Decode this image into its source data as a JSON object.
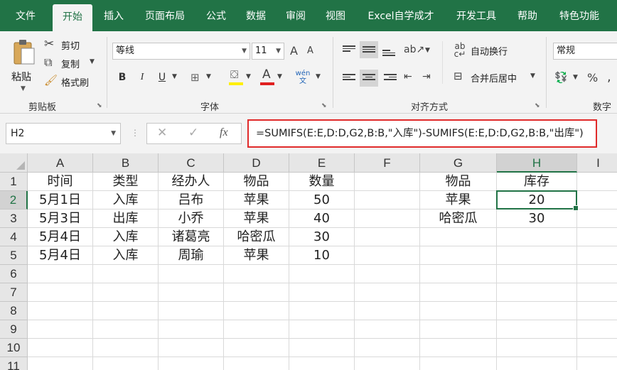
{
  "tabs": [
    {
      "label": "文件",
      "active": false
    },
    {
      "label": "开始",
      "active": true
    },
    {
      "label": "插入",
      "active": false
    },
    {
      "label": "页面布局",
      "active": false
    },
    {
      "label": "公式",
      "active": false
    },
    {
      "label": "数据",
      "active": false
    },
    {
      "label": "审阅",
      "active": false
    },
    {
      "label": "视图",
      "active": false
    },
    {
      "label": "Excel自学成才",
      "active": false
    },
    {
      "label": "开发工具",
      "active": false
    },
    {
      "label": "帮助",
      "active": false
    },
    {
      "label": "特色功能",
      "active": false
    }
  ],
  "ribbon": {
    "clipboard": {
      "paste": "粘贴",
      "cut": "剪切",
      "copy": "复制",
      "format_painter": "格式刷",
      "label": "剪贴板"
    },
    "font": {
      "name": "等线",
      "size": "11",
      "bold": "B",
      "italic": "I",
      "underline": "U",
      "grow": "A",
      "shrink": "A",
      "color_letter": "A",
      "phonetic": "wén文",
      "label": "字体"
    },
    "alignment": {
      "wrap_text": "自动换行",
      "merge_center": "合并后居中",
      "label": "对齐方式"
    },
    "number": {
      "format": "常规",
      "label": "数字"
    }
  },
  "formula_bar": {
    "name_box": "H2",
    "fx": "fx",
    "formula": "=SUMIFS(E:E,D:D,G2,B:B,\"入库\")-SUMIFS(E:E,D:D,G2,B:B,\"出库\")"
  },
  "sheet": {
    "columns": [
      "A",
      "B",
      "C",
      "D",
      "E",
      "F",
      "G",
      "H",
      "I"
    ],
    "rows": [
      "1",
      "2",
      "3",
      "4",
      "5",
      "6",
      "7",
      "8",
      "9",
      "10",
      "11"
    ],
    "selected_column": "H",
    "selected_row": "2",
    "cells": [
      [
        "时间",
        "类型",
        "经办人",
        "物品",
        "数量",
        "",
        "物品",
        "库存",
        ""
      ],
      [
        "5月1日",
        "入库",
        "吕布",
        "苹果",
        "50",
        "",
        "苹果",
        "20",
        ""
      ],
      [
        "5月3日",
        "出库",
        "小乔",
        "苹果",
        "40",
        "",
        "哈密瓜",
        "30",
        ""
      ],
      [
        "5月4日",
        "入库",
        "诸葛亮",
        "哈密瓜",
        "30",
        "",
        "",
        "",
        ""
      ],
      [
        "5月4日",
        "入库",
        "周瑜",
        "苹果",
        "10",
        "",
        "",
        "",
        ""
      ],
      [
        "",
        "",
        "",
        "",
        "",
        "",
        "",
        "",
        ""
      ],
      [
        "",
        "",
        "",
        "",
        "",
        "",
        "",
        "",
        ""
      ],
      [
        "",
        "",
        "",
        "",
        "",
        "",
        "",
        "",
        ""
      ],
      [
        "",
        "",
        "",
        "",
        "",
        "",
        "",
        "",
        ""
      ],
      [
        "",
        "",
        "",
        "",
        "",
        "",
        "",
        "",
        ""
      ],
      [
        "",
        "",
        "",
        "",
        "",
        "",
        "",
        "",
        ""
      ]
    ]
  }
}
